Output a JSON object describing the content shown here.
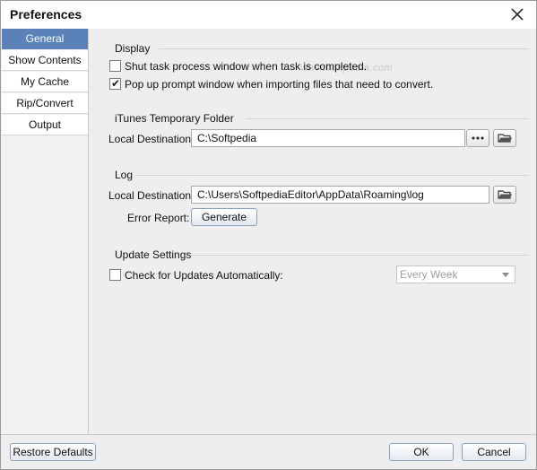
{
  "window": {
    "title": "Preferences",
    "close_icon": "close-icon"
  },
  "sidebar": {
    "items": [
      {
        "label": "General",
        "active": true
      },
      {
        "label": "Show Contents",
        "active": false
      },
      {
        "label": "My Cache",
        "active": false
      },
      {
        "label": "Rip/Convert",
        "active": false
      },
      {
        "label": "Output",
        "active": false
      }
    ]
  },
  "display": {
    "title": "Display",
    "shut_task": {
      "label": "Shut task process window when task is completed.",
      "checked": false
    },
    "popup_prompt": {
      "label": "Pop up prompt window when importing files that need to convert.",
      "checked": true
    }
  },
  "itunes": {
    "title": "iTunes Temporary Folder",
    "dest_label": "Local Destination:",
    "dest_value": "C:\\Softpedia",
    "browse_icon": "more-dots-icon",
    "open_folder_icon": "folder-open-icon"
  },
  "log": {
    "title": "Log",
    "dest_label": "Local Destination:",
    "dest_value": "C:\\Users\\SoftpediaEditor\\AppData\\Roaming\\log",
    "open_folder_icon": "folder-open-icon",
    "error_report_label": "Error Report:",
    "generate_label": "Generate"
  },
  "update": {
    "title": "Update Settings",
    "auto_check": {
      "label": "Check for Updates Automatically:",
      "checked": false
    },
    "frequency": {
      "selected": "Every Week",
      "enabled": false
    }
  },
  "footer": {
    "restore_label": "Restore Defaults",
    "ok_label": "OK",
    "cancel_label": "Cancel"
  },
  "watermark": "www.softpedia.com",
  "colors": {
    "accent": "#5a82b9",
    "panel_bg": "#eeeeee",
    "sidebar_bg": "#f2f2f2"
  }
}
